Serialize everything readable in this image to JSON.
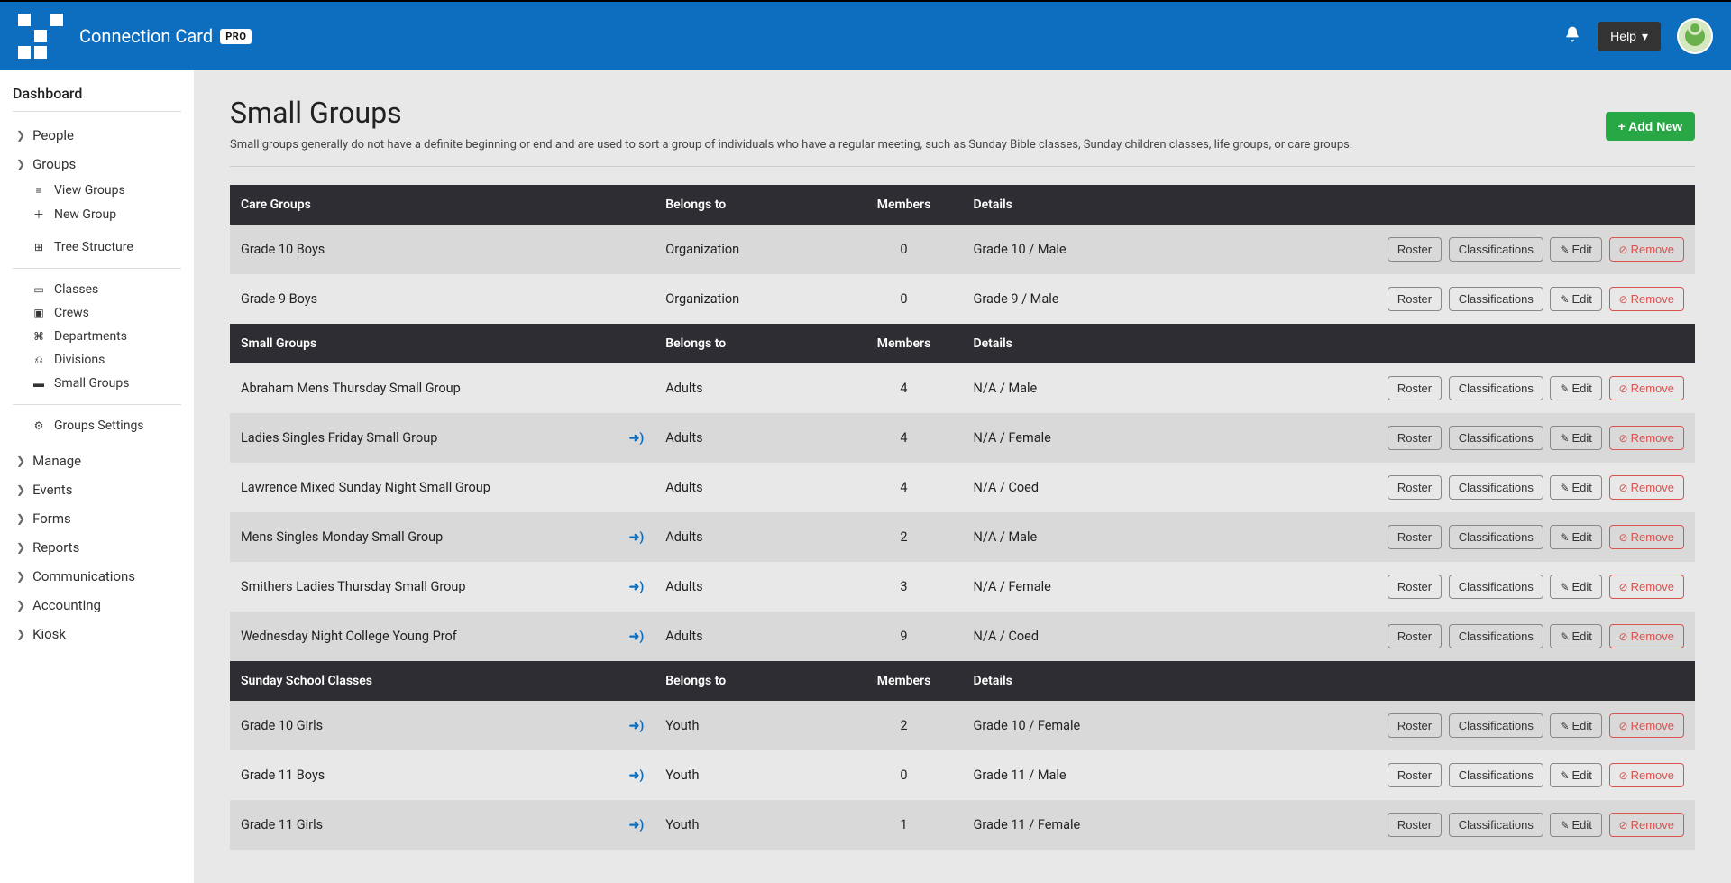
{
  "topbar": {
    "brand": "Connection Card",
    "pro": "PRO",
    "help": "Help"
  },
  "sidebar": {
    "dashboard": "Dashboard",
    "people": "People",
    "groups": "Groups",
    "view_groups": "View Groups",
    "new_group": "New Group",
    "tree_structure": "Tree Structure",
    "classes": "Classes",
    "crews": "Crews",
    "departments": "Departments",
    "divisions": "Divisions",
    "small_groups": "Small Groups",
    "groups_settings": "Groups Settings",
    "manage": "Manage",
    "events": "Events",
    "forms": "Forms",
    "reports": "Reports",
    "communications": "Communications",
    "accounting": "Accounting",
    "kiosk": "Kiosk"
  },
  "page": {
    "title": "Small Groups",
    "subtitle": "Small groups generally do not have a definite beginning or end and are used to sort a group of individuals who have a regular meeting, such as Sunday Bible classes, Sunday children classes, life groups, or care groups.",
    "add_new": "+ Add New"
  },
  "columns": {
    "belongs_to": "Belongs to",
    "members": "Members",
    "details": "Details"
  },
  "buttons": {
    "roster": "Roster",
    "classifications": "Classifications",
    "edit": "Edit",
    "remove": "Remove"
  },
  "sections": [
    {
      "header": "Care Groups",
      "rows": [
        {
          "name": "Grade 10 Boys",
          "login": false,
          "belongs": "Organization",
          "members": "0",
          "details": "Grade 10 / Male"
        },
        {
          "name": "Grade 9 Boys",
          "login": false,
          "belongs": "Organization",
          "members": "0",
          "details": "Grade 9 / Male"
        }
      ]
    },
    {
      "header": "Small Groups",
      "rows": [
        {
          "name": "Abraham Mens Thursday Small Group",
          "login": false,
          "belongs": "Adults",
          "members": "4",
          "details": "N/A / Male"
        },
        {
          "name": "Ladies Singles Friday Small Group",
          "login": true,
          "belongs": "Adults",
          "members": "4",
          "details": "N/A / Female"
        },
        {
          "name": "Lawrence Mixed Sunday Night Small Group",
          "login": false,
          "belongs": "Adults",
          "members": "4",
          "details": "N/A / Coed"
        },
        {
          "name": "Mens Singles Monday Small Group",
          "login": true,
          "belongs": "Adults",
          "members": "2",
          "details": "N/A / Male"
        },
        {
          "name": "Smithers Ladies Thursday Small Group",
          "login": true,
          "belongs": "Adults",
          "members": "3",
          "details": "N/A / Female"
        },
        {
          "name": "Wednesday Night College Young Prof",
          "login": true,
          "belongs": "Adults",
          "members": "9",
          "details": "N/A / Coed"
        }
      ]
    },
    {
      "header": "Sunday School Classes",
      "rows": [
        {
          "name": "Grade 10 Girls",
          "login": true,
          "belongs": "Youth",
          "members": "2",
          "details": "Grade 10 / Female"
        },
        {
          "name": "Grade 11 Boys",
          "login": true,
          "belongs": "Youth",
          "members": "0",
          "details": "Grade 11 / Male"
        },
        {
          "name": "Grade 11 Girls",
          "login": true,
          "belongs": "Youth",
          "members": "1",
          "details": "Grade 11 / Female"
        }
      ]
    }
  ]
}
